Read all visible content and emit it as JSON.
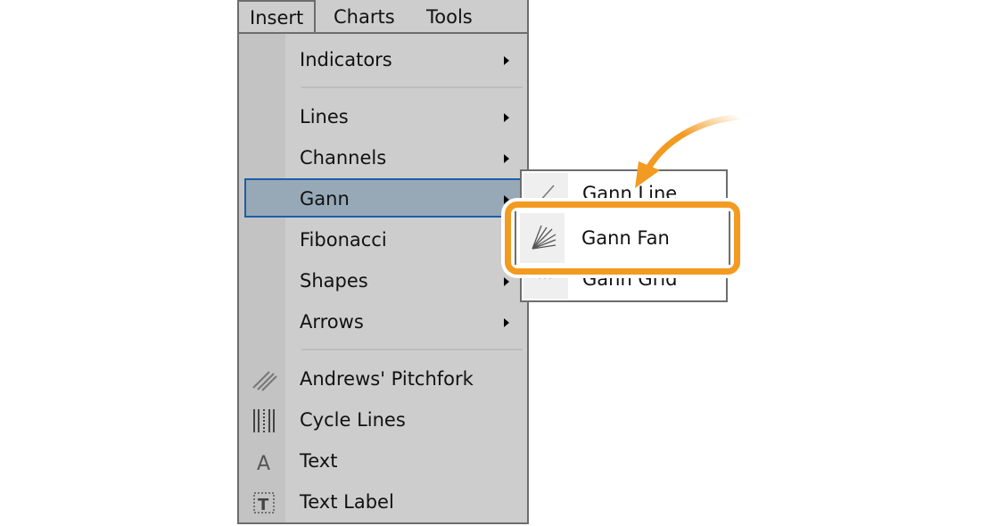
{
  "menubar": {
    "items": [
      "Insert",
      "Charts",
      "Tools"
    ]
  },
  "insert_menu": {
    "items": [
      {
        "label": "Indicators",
        "submenu": true
      },
      {
        "label": "Lines",
        "submenu": true
      },
      {
        "label": "Channels",
        "submenu": true
      },
      {
        "label": "Gann",
        "submenu": true,
        "highlighted": true
      },
      {
        "label": "Fibonacci",
        "submenu": true
      },
      {
        "label": "Shapes",
        "submenu": true
      },
      {
        "label": "Arrows",
        "submenu": true
      },
      {
        "label": "Andrews' Pitchfork",
        "icon": "pitchfork-icon"
      },
      {
        "label": "Cycle Lines",
        "icon": "cycle-lines-icon"
      },
      {
        "label": "Text",
        "icon": "text-icon"
      },
      {
        "label": "Text Label",
        "icon": "text-label-icon"
      }
    ]
  },
  "gann_submenu": {
    "items": [
      {
        "label": "Gann Line",
        "icon": "gann-line-icon"
      },
      {
        "label": "Gann Fan",
        "icon": "gann-fan-icon",
        "highlighted": true
      },
      {
        "label": "Gann Grid",
        "icon": "gann-grid-icon"
      }
    ]
  },
  "annotation": {
    "color": "#f39a21",
    "target": "Gann Fan"
  }
}
